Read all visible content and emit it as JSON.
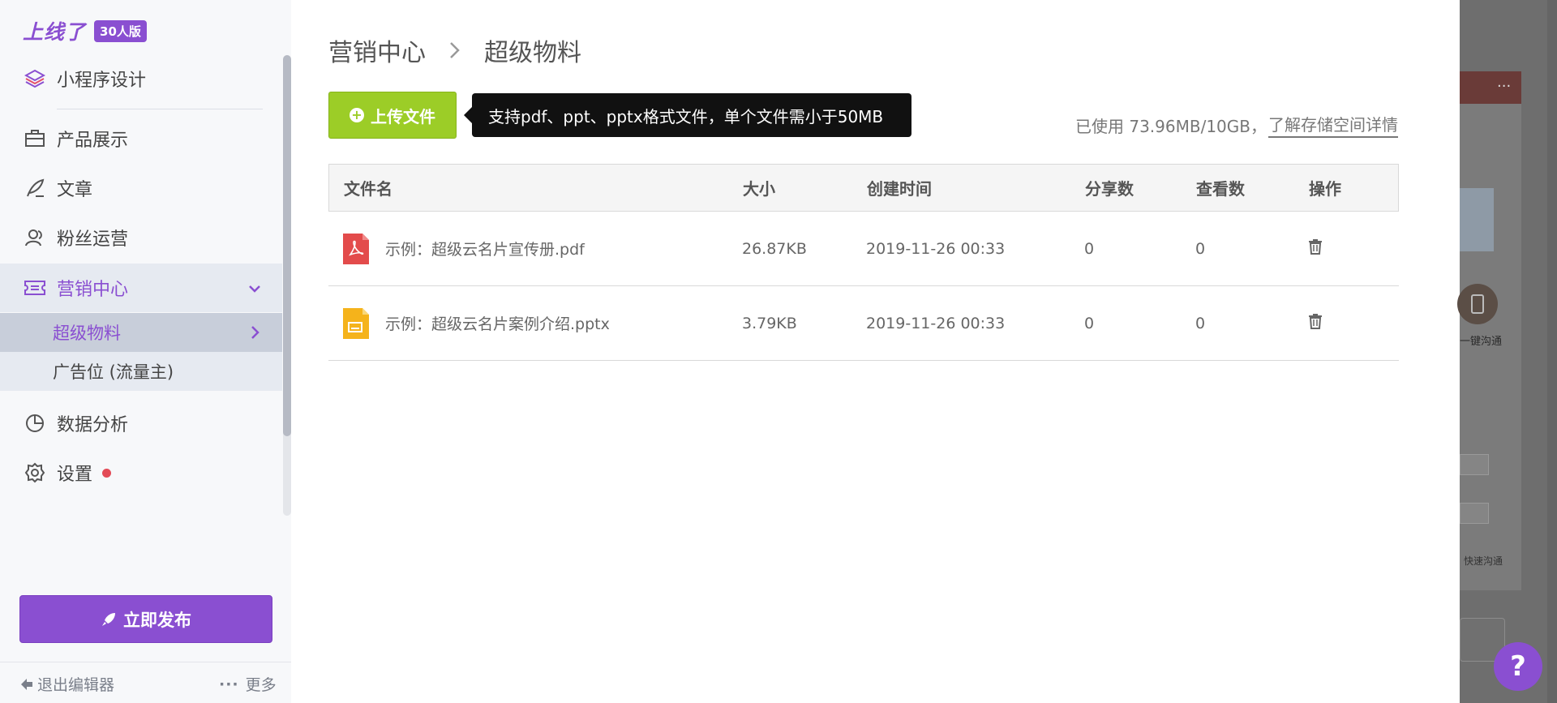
{
  "sidebar": {
    "logo_text": "上线了",
    "logo_badge": "30人版",
    "items": [
      {
        "label": "小程序设计"
      },
      {
        "label": "产品展示"
      },
      {
        "label": "文章"
      },
      {
        "label": "粉丝运营"
      },
      {
        "label": "营销中心"
      },
      {
        "label": "数据分析"
      },
      {
        "label": "设置"
      }
    ],
    "subitems": [
      {
        "label": "超级物料"
      },
      {
        "label": "广告位 (流量主)"
      }
    ],
    "publish_label": "立即发布",
    "exit_label": "退出编辑器",
    "more_label": "更多"
  },
  "main": {
    "breadcrumb": [
      "营销中心",
      "超级物料"
    ],
    "upload_label": "上传文件",
    "tooltip": "支持pdf、ppt、pptx格式文件，单个文件需小于50MB",
    "storage_used": "已使用 73.96MB/10GB，",
    "storage_link": "了解存储空间详情",
    "table": {
      "headers": [
        "文件名",
        "大小",
        "创建时间",
        "分享数",
        "查看数",
        "操作"
      ],
      "rows": [
        {
          "name": "示例：超级云名片宣传册.pdf",
          "size": "26.87KB",
          "created": "2019-11-26 00:33",
          "shares": "0",
          "views": "0",
          "type": "pdf"
        },
        {
          "name": "示例：超级云名片案例介绍.pptx",
          "size": "3.79KB",
          "created": "2019-11-26 00:33",
          "shares": "0",
          "views": "0",
          "type": "pptx"
        }
      ]
    }
  },
  "preview": {
    "phone_label": "一键沟通",
    "call_label": "快速沟通"
  },
  "help_label": "?",
  "colors": {
    "accent": "#8a4fd1",
    "upload_green": "#9ccd27",
    "pdf_red": "#e34b4b",
    "pptx_orange": "#f5b31b",
    "notify_dot": "#e34b57"
  }
}
